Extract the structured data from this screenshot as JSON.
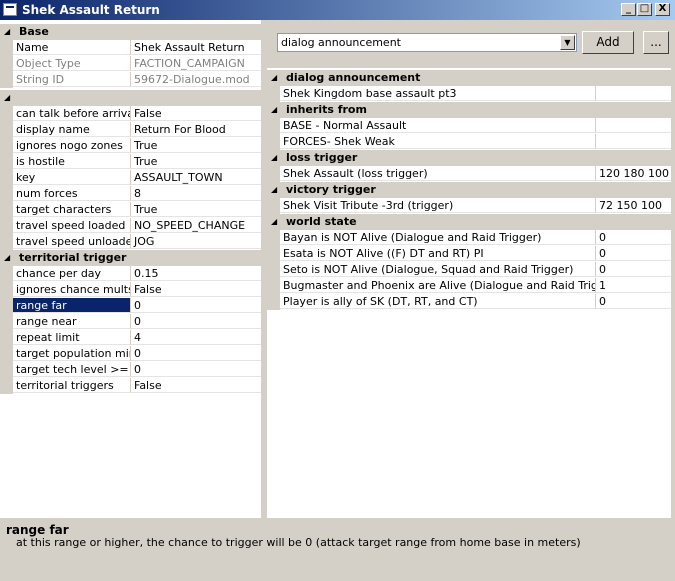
{
  "window": {
    "title": "Shek Assault Return",
    "min_glyph": "_",
    "max_glyph": "□",
    "close_glyph": "X"
  },
  "left_grid": {
    "base_category": "Base",
    "base_props": [
      {
        "name": "Name",
        "value": "Shek Assault Return",
        "dim": false
      },
      {
        "name": "Object Type",
        "value": "FACTION_CAMPAIGN",
        "dim": true
      },
      {
        "name": "String ID",
        "value": "59672-Dialogue.mod",
        "dim": true
      }
    ],
    "misc_category": "",
    "misc_props": [
      {
        "name": "can talk before arrival",
        "value": "False"
      },
      {
        "name": "display name",
        "value": "Return For Blood"
      },
      {
        "name": "ignores nogo zones",
        "value": "True"
      },
      {
        "name": "is hostile",
        "value": "True"
      },
      {
        "name": "key",
        "value": "ASSAULT_TOWN"
      },
      {
        "name": "num forces",
        "value": "8"
      },
      {
        "name": "target characters",
        "value": "True"
      },
      {
        "name": "travel speed loaded",
        "value": "NO_SPEED_CHANGE"
      },
      {
        "name": "travel speed unloaded",
        "value": "JOG"
      }
    ],
    "territorial_category": "territorial trigger",
    "territorial_props": [
      {
        "name": "chance per day",
        "value": "0.15"
      },
      {
        "name": "ignores chance mults",
        "value": "False"
      },
      {
        "name": "range far",
        "value": "0"
      },
      {
        "name": "range near",
        "value": "0"
      },
      {
        "name": "repeat limit",
        "value": "4"
      },
      {
        "name": "target population min",
        "value": "0"
      },
      {
        "name": "target tech level >=",
        "value": "0"
      },
      {
        "name": "territorial triggers",
        "value": "False"
      }
    ],
    "selected_prop": "range far"
  },
  "toolbar": {
    "combo_value": "dialog announcement",
    "add_label": "Add",
    "more_label": "..."
  },
  "right_grid": {
    "categories": [
      {
        "label": "dialog announcement",
        "rows": [
          {
            "name": "Shek Kingdom base assault pt3",
            "value": ""
          }
        ]
      },
      {
        "label": "inherits from",
        "rows": [
          {
            "name": "BASE - Normal Assault",
            "value": ""
          },
          {
            "name": "FORCES- Shek Weak",
            "value": ""
          }
        ]
      },
      {
        "label": "loss trigger",
        "rows": [
          {
            "name": "Shek Assault (loss trigger)",
            "value": "120  180  100"
          }
        ]
      },
      {
        "label": "victory trigger",
        "rows": [
          {
            "name": "Shek Visit Tribute -3rd (trigger)",
            "value": "72   150  100"
          }
        ]
      },
      {
        "label": "world state",
        "rows": [
          {
            "name": "Bayan is NOT Alive (Dialogue and Raid Trigger)",
            "value": "0"
          },
          {
            "name": "Esata is NOT Alive ((F) DT and RT) PI",
            "value": "0"
          },
          {
            "name": "Seto is NOT Alive (Dialogue, Squad and Raid Trigger)",
            "value": "0"
          },
          {
            "name": "Bugmaster and Phoenix are Alive (Dialogue and Raid Trigger)",
            "value": "1"
          },
          {
            "name": "Player is ally of SK (DT, RT, and CT)",
            "value": "0"
          }
        ]
      }
    ]
  },
  "description": {
    "title": "range far",
    "text": "at this range or higher, the chance to trigger will be 0 (attack target range from home base in meters)"
  }
}
